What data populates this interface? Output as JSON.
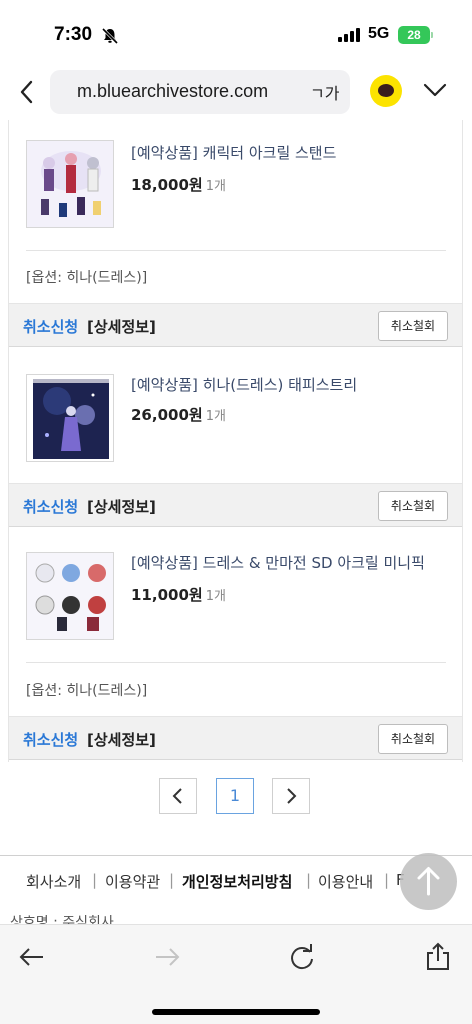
{
  "status_bar": {
    "time": "7:30",
    "network": "5G",
    "battery": "28"
  },
  "address_bar": {
    "url": "m.bluearchivestore.com",
    "font_size_label": "ㄱ가"
  },
  "orders": [
    {
      "name": "[예약상품] 캐릭터 아크릴 스탠드",
      "price": "18,000원",
      "qty": "1개",
      "option": "[옵션: 히나(드레스)]"
    },
    {
      "name": "[예약상품] 히나(드레스) 태피스트리",
      "price": "26,000원",
      "qty": "1개",
      "option": ""
    },
    {
      "name": "[예약상품] 드레스 & 만마전 SD 아크릴 미니픽",
      "price": "11,000원",
      "qty": "1개",
      "option": "[옵션: 히나(드레스)]"
    }
  ],
  "actions": {
    "cancel_request": "취소신청",
    "detail": "[상세정보]",
    "withdraw": "취소철회"
  },
  "pagination": {
    "current": "1"
  },
  "footer": {
    "links": [
      "회사소개",
      "이용약관",
      "개인정보처리방침",
      "이용안내",
      "F"
    ],
    "below_text": "상호명 : 주식회사..."
  },
  "colors": {
    "accent_blue": "#2a78d6",
    "kakao_yellow": "#fce300",
    "battery_green": "#34c759"
  },
  "icons": [
    "bell-slash-icon",
    "signal-icon",
    "back-chevron-icon",
    "kakao-talk-icon",
    "chevron-down-icon",
    "prev-page-icon",
    "next-page-icon",
    "arrow-up-icon",
    "browser-back-icon",
    "browser-forward-icon",
    "reload-icon",
    "share-icon"
  ]
}
